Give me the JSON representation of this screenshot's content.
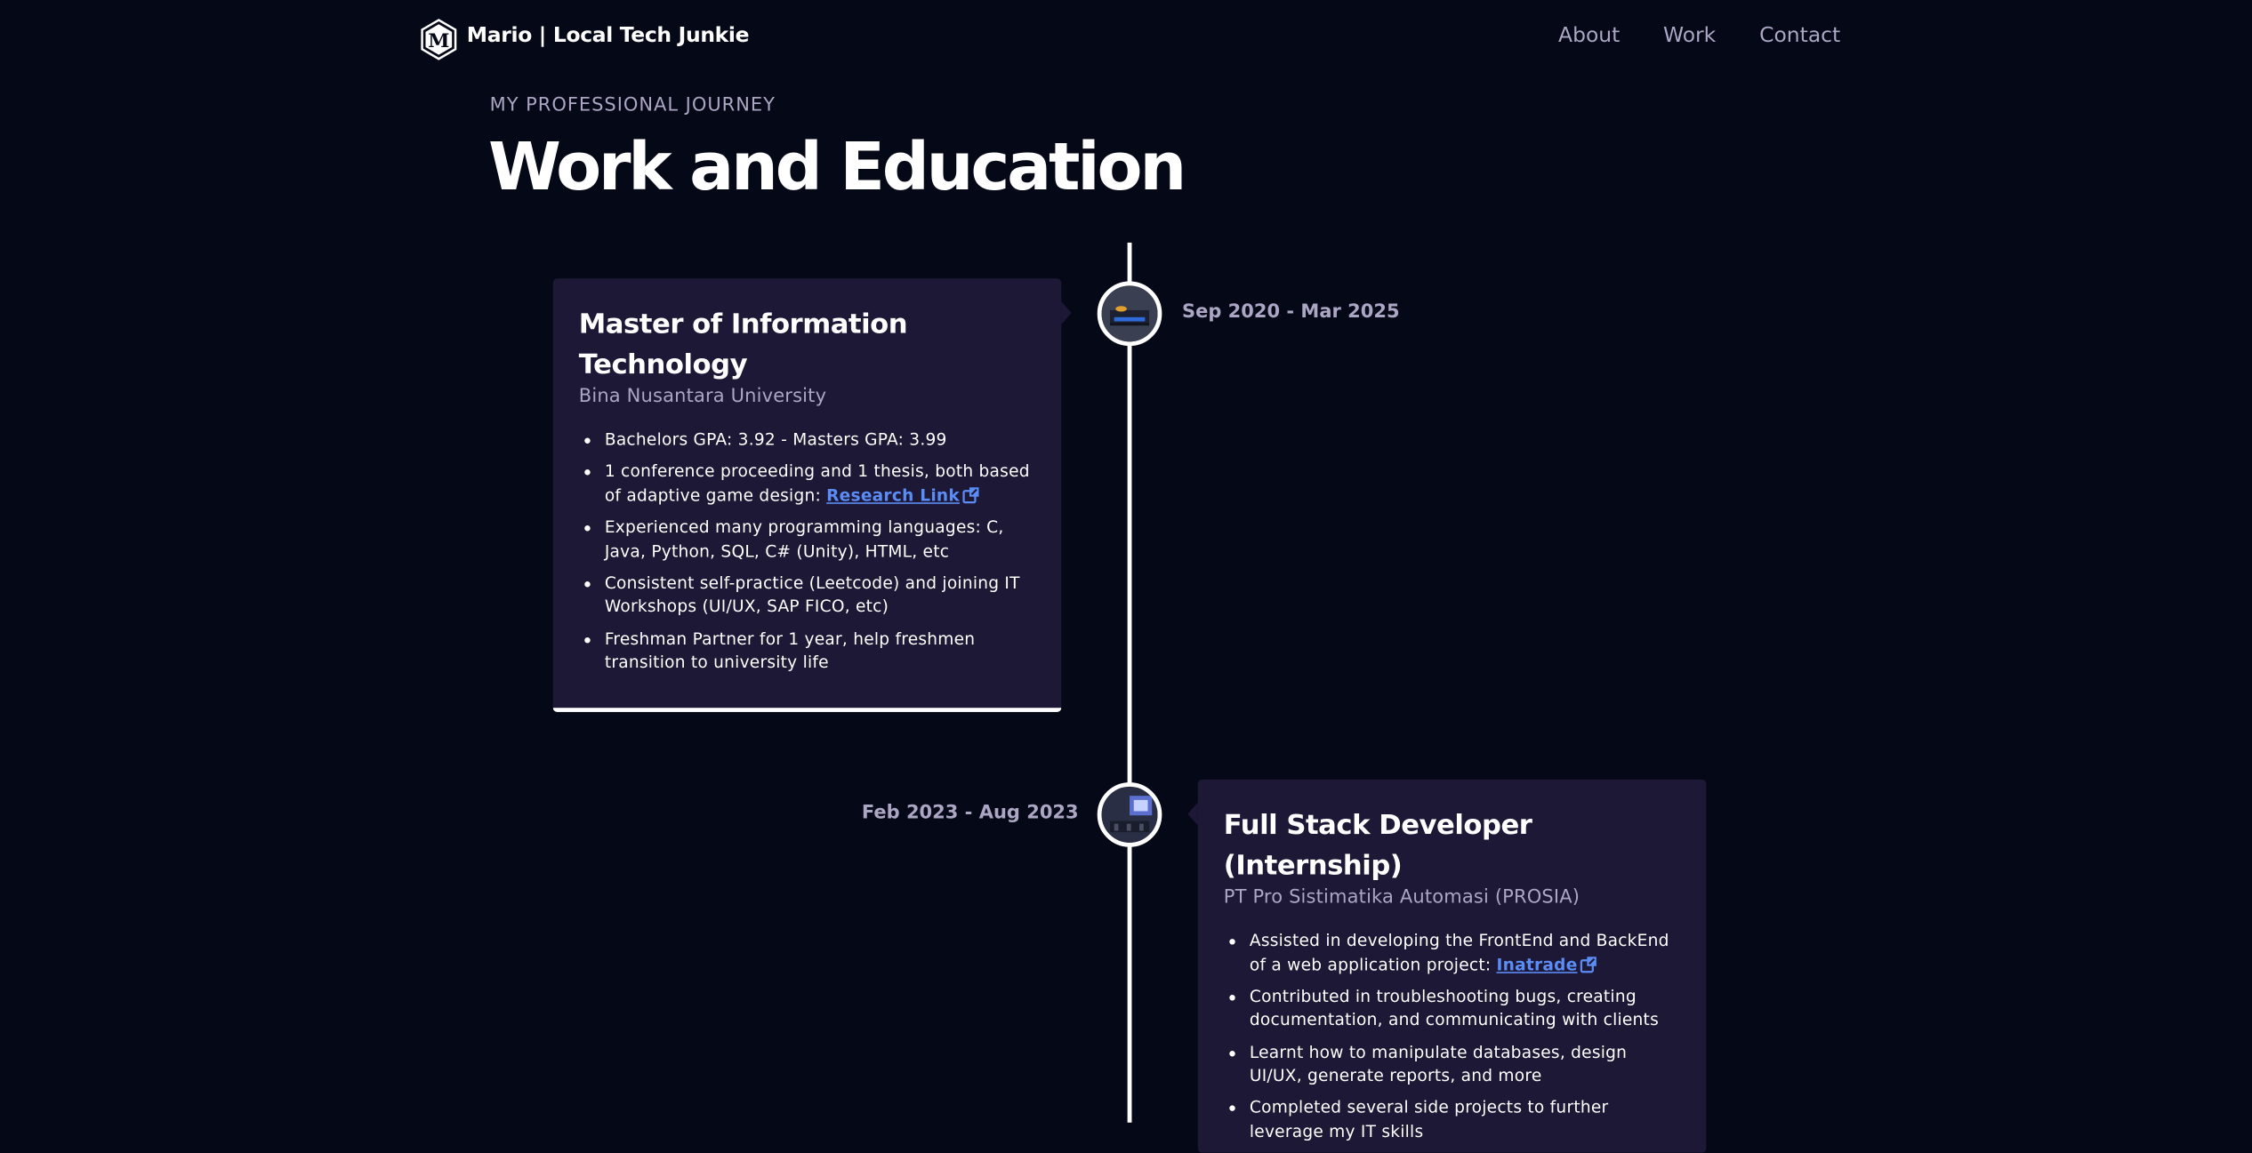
{
  "nav": {
    "brand": "Mario | Local Tech Junkie",
    "links": [
      "About",
      "Work",
      "Contact"
    ]
  },
  "hero": {
    "subtitle": "MY PROFESSIONAL JOURNEY",
    "title": "Work and Education"
  },
  "timeline": [
    {
      "title": "Master of Information Technology",
      "company": "Bina Nusantara University",
      "date": "Sep 2020 - Mar 2025",
      "points": [
        "Bachelors GPA: 3.92 - Masters GPA: 3.99",
        "1 conference proceeding and 1 thesis, both based of adaptive game design: ",
        "Experienced many programming languages: C, Java, Python, SQL, C# (Unity), HTML, etc",
        "Consistent self-practice (Leetcode) and joining IT Workshops (UI/UX, SAP FICO, etc)",
        "Freshman Partner for 1 year, help freshmen transition to university life"
      ],
      "link_label": "Research Link"
    },
    {
      "title": "Full Stack Developer (Internship)",
      "company": "PT Pro Sistimatika Automasi (PROSIA)",
      "date": "Feb 2023 - Aug 2023",
      "points": [
        "Assisted in developing the FrontEnd and BackEnd of a web application project: ",
        "Contributed in troubleshooting bugs, creating documentation, and communicating with clients",
        "Learnt how to manipulate databases, design UI/UX, generate reports, and more",
        "Completed several side projects to further leverage my IT skills"
      ],
      "link_label": "Inatrade"
    }
  ],
  "colors": {
    "background": "#050816",
    "card": "#1d1836",
    "secondary_text": "#aaa6c3",
    "link": "#5b8cf5"
  }
}
